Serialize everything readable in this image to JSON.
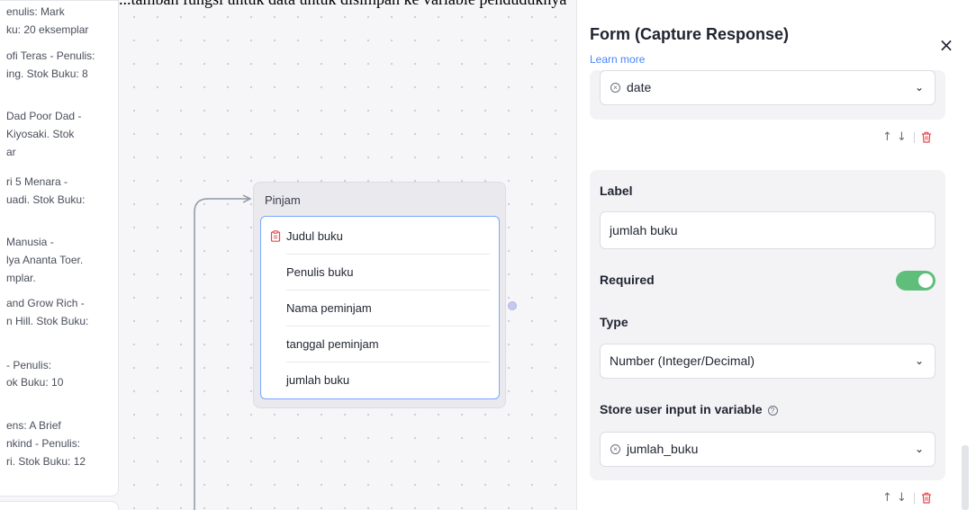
{
  "caption": "...tambah fungsi untuk data untuk disimpan ke variable penduduknya",
  "left_list": [
    "enulis: Mark",
    "ku: 20 eksemplar",
    "ofi Teras - Penulis:",
    "ing. Stok Buku: 8",
    "Dad Poor Dad -",
    "Kiyosaki. Stok",
    "ar",
    "ri 5 Menara -",
    "uadi. Stok Buku:",
    "Manusia -",
    "lya Ananta Toer.",
    "mplar.",
    "and Grow Rich -",
    "n Hill. Stok Buku:",
    "- Penulis:",
    "ok Buku: 10",
    "ens: A Brief",
    "nkind - Penulis:",
    "ri. Stok Buku: 12"
  ],
  "group": {
    "title": "Pinjam",
    "fields": [
      {
        "label": "Judul buku",
        "icon": "clipboard-icon"
      },
      {
        "label": "Penulis buku"
      },
      {
        "label": "Nama peminjam"
      },
      {
        "label": "tanggal peminjam"
      },
      {
        "label": "jumlah buku"
      }
    ]
  },
  "panel": {
    "title": "Form (Capture Response)",
    "learn_more": "Learn more",
    "close_icon": "×",
    "prev_variable": "date",
    "label_heading": "Label",
    "label_value": "jumlah buku",
    "required_heading": "Required",
    "required_on": true,
    "type_heading": "Type",
    "type_value": "Number (Integer/Decimal)",
    "store_heading": "Store user input in variable",
    "store_value": "jumlah_buku",
    "colors": {
      "accent_link": "#4a86f7",
      "toggle_on": "#5fbf7a",
      "delete_red": "#e5484d",
      "block_border": "#7aa7ff"
    }
  }
}
